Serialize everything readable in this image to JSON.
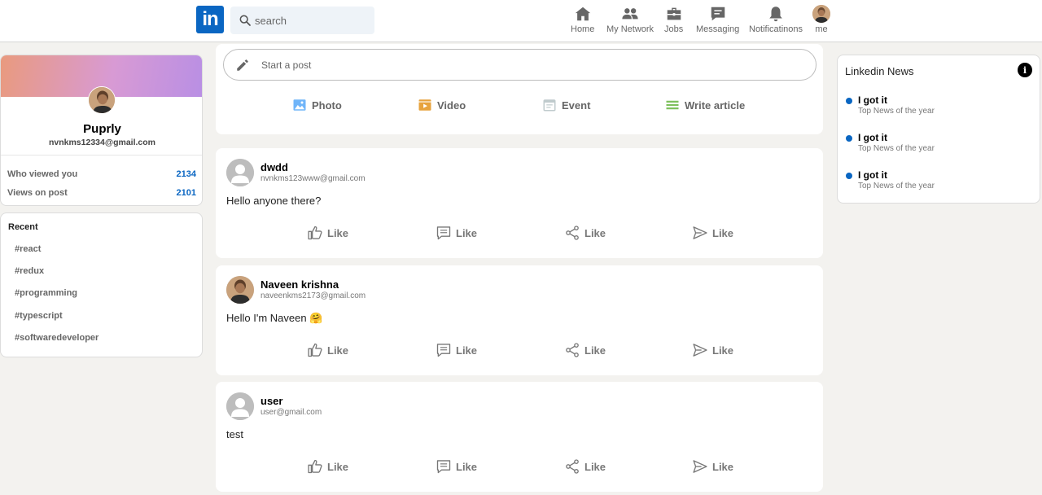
{
  "header": {
    "logo": "in",
    "search_placeholder": "search",
    "nav": [
      {
        "label": "Home",
        "icon": "home-icon"
      },
      {
        "label": "My Network",
        "icon": "network-icon"
      },
      {
        "label": "Jobs",
        "icon": "briefcase-icon"
      },
      {
        "label": "Messaging",
        "icon": "message-icon"
      },
      {
        "label": "Notificatinons",
        "icon": "bell-icon"
      },
      {
        "label": "me",
        "icon": "avatar"
      }
    ]
  },
  "profile": {
    "name": "Puprly",
    "email": "nvnkms12334@gmail.com",
    "stats": [
      {
        "label": "Who viewed you",
        "value": "2134"
      },
      {
        "label": "Views on post",
        "value": "2101"
      }
    ]
  },
  "recent": {
    "title": "Recent",
    "tags": [
      "#react",
      "#redux",
      "#programming",
      "#typescript",
      "#softwaredeveloper"
    ]
  },
  "composer": {
    "placeholder": "Start a post",
    "options": [
      {
        "label": "Photo",
        "icon": "photo-icon",
        "color": "#70b5f9"
      },
      {
        "label": "Video",
        "icon": "video-icon",
        "color": "#e7a33e"
      },
      {
        "label": "Event",
        "icon": "event-icon",
        "color": "#c0cbcd"
      },
      {
        "label": "Write article",
        "icon": "article-icon",
        "color": "#7fc15e"
      }
    ]
  },
  "posts": [
    {
      "name": "dwdd",
      "email": "nvnkms123www@gmail.com",
      "text": "Hello anyone there?",
      "avatar": "default"
    },
    {
      "name": "Naveen krishna",
      "email": "naveenkms2173@gmail.com",
      "text": "Hello I'm Naveen 🤗",
      "avatar": "photo"
    },
    {
      "name": "user",
      "email": "user@gmail.com",
      "text": "test",
      "avatar": "default"
    }
  ],
  "post_actions": [
    {
      "label": "Like",
      "icon": "thumbs-up-icon"
    },
    {
      "label": "Like",
      "icon": "comment-icon"
    },
    {
      "label": "Like",
      "icon": "share-icon"
    },
    {
      "label": "Like",
      "icon": "send-icon"
    }
  ],
  "news": {
    "title": "Linkedin News",
    "items": [
      {
        "headline": "I got it",
        "subtitle": "Top News of the year"
      },
      {
        "headline": "I got it",
        "subtitle": "Top News of the year"
      },
      {
        "headline": "I got it",
        "subtitle": "Top News of the year"
      }
    ]
  },
  "colors": {
    "brand": "#0a66c2",
    "background": "#f3f2ef"
  }
}
